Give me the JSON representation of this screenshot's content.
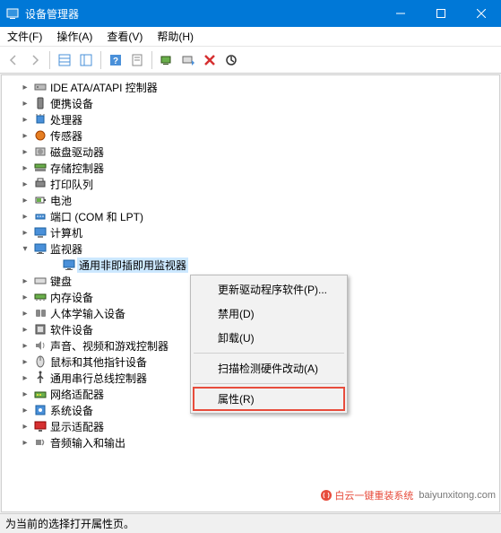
{
  "window": {
    "title": "设备管理器"
  },
  "menubar": {
    "file": "文件(F)",
    "action": "操作(A)",
    "view": "查看(V)",
    "help": "帮助(H)"
  },
  "tree": {
    "items": [
      {
        "label": "IDE ATA/ATAPI 控制器",
        "icon": "ide"
      },
      {
        "label": "便携设备",
        "icon": "portable"
      },
      {
        "label": "处理器",
        "icon": "cpu"
      },
      {
        "label": "传感器",
        "icon": "sensor"
      },
      {
        "label": "磁盘驱动器",
        "icon": "disk"
      },
      {
        "label": "存储控制器",
        "icon": "storage"
      },
      {
        "label": "打印队列",
        "icon": "printer"
      },
      {
        "label": "电池",
        "icon": "battery"
      },
      {
        "label": "端口 (COM 和 LPT)",
        "icon": "port"
      },
      {
        "label": "计算机",
        "icon": "computer"
      },
      {
        "label": "监视器",
        "icon": "monitor",
        "expanded": true,
        "children": [
          {
            "label": "通用非即插即用监视器",
            "icon": "monitor",
            "selected": true
          }
        ]
      },
      {
        "label": "键盘",
        "icon": "keyboard"
      },
      {
        "label": "内存设备",
        "icon": "memory"
      },
      {
        "label": "人体学输入设备",
        "icon": "hid"
      },
      {
        "label": "软件设备",
        "icon": "software"
      },
      {
        "label": "声音、视频和游戏控制器",
        "icon": "sound"
      },
      {
        "label": "鼠标和其他指针设备",
        "icon": "mouse"
      },
      {
        "label": "通用串行总线控制器",
        "icon": "usb"
      },
      {
        "label": "网络适配器",
        "icon": "network"
      },
      {
        "label": "系统设备",
        "icon": "system"
      },
      {
        "label": "显示适配器",
        "icon": "display"
      },
      {
        "label": "音频输入和输出",
        "icon": "audio"
      }
    ]
  },
  "context_menu": {
    "update_driver": "更新驱动程序软件(P)...",
    "disable": "禁用(D)",
    "uninstall": "卸载(U)",
    "scan": "扫描检测硬件改动(A)",
    "properties": "属性(R)"
  },
  "statusbar": {
    "text": "为当前的选择打开属性页。"
  },
  "watermark": {
    "brand": "白云一键重装系统",
    "url": "baiyunxitong.com"
  },
  "colors": {
    "titlebar": "#0078d7",
    "highlight_border": "#e74c3c",
    "selection": "#cce8ff"
  }
}
